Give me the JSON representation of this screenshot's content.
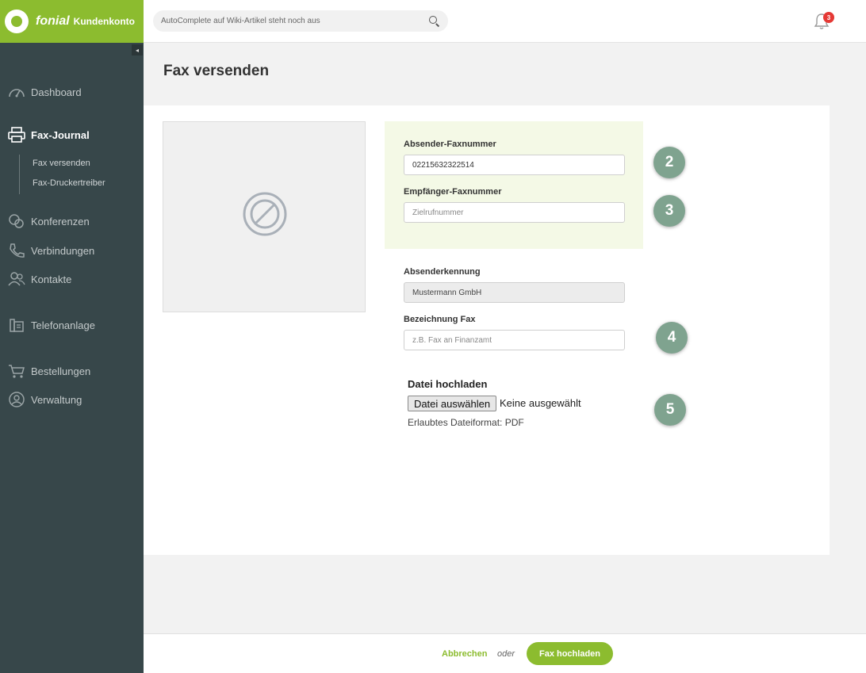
{
  "brand": {
    "name": "fonial",
    "subtitle": "Kundenkonto",
    "color": "#8cbc2f"
  },
  "search": {
    "placeholder": "AutoComplete auf Wiki-Artikel steht noch aus"
  },
  "notifications": {
    "count": "3"
  },
  "sidebar": {
    "collapse_glyph": "◂",
    "items": [
      {
        "label": "Dashboard",
        "icon": "speedometer-icon"
      },
      {
        "label": "Fax-Journal",
        "icon": "printer-icon",
        "active": true,
        "children": [
          {
            "label": "Fax versenden"
          },
          {
            "label": "Fax-Druckertreiber"
          }
        ]
      },
      {
        "label": "Konferenzen",
        "icon": "conference-icon"
      },
      {
        "label": "Verbindungen",
        "icon": "phone-icon"
      },
      {
        "label": "Kontakte",
        "icon": "contacts-icon"
      },
      {
        "label": "Telefonanlage",
        "icon": "phone-system-icon"
      },
      {
        "label": "Bestellungen",
        "icon": "cart-icon"
      },
      {
        "label": "Verwaltung",
        "icon": "user-icon"
      }
    ]
  },
  "page": {
    "title": "Fax versenden"
  },
  "form": {
    "sender_fax": {
      "label": "Absender-Faxnummer",
      "value": "02215632322514"
    },
    "recipient_fax": {
      "label": "Empfänger-Faxnummer",
      "placeholder": "Zielrufnummer"
    },
    "sender_id": {
      "label": "Absenderkennung",
      "value": "Mustermann GmbH"
    },
    "fax_title": {
      "label": "Bezeichnung Fax",
      "placeholder": "z.B. Fax an Finanzamt"
    },
    "upload": {
      "label": "Datei hochladen",
      "button": "Datei auswählen",
      "status": "Keine ausgewählt",
      "format": "Erlaubtes Dateiformat: PDF"
    }
  },
  "steps": [
    "2",
    "3",
    "4",
    "5"
  ],
  "footer": {
    "cancel": "Abbrechen",
    "or": "oder",
    "submit": "Fax hochladen"
  }
}
